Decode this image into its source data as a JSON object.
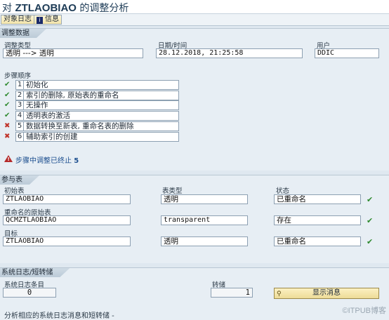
{
  "title": {
    "prefix": "对",
    "object": "ZTLAOBIAO",
    "suffix": "的调整分析"
  },
  "toolbar": {
    "object_log": "对象日志",
    "info": "信息",
    "info_icon": "info-icon"
  },
  "adjust_data": {
    "section_title": "调整数据",
    "adjust_type_label": "调整类型",
    "adjust_type_value": "透明 ---> 透明",
    "datetime_label": "日期/时间",
    "datetime_value": "28.12.2018, 21:25:58",
    "user_label": "用户",
    "user_value": "DDIC"
  },
  "steps": {
    "label": "步骤顺序",
    "items": [
      {
        "status": "ok",
        "icon": "✔",
        "num": "1",
        "text": "初始化"
      },
      {
        "status": "ok",
        "icon": "✔",
        "num": "2",
        "text": "索引的删除, 原始表的重命名"
      },
      {
        "status": "ok",
        "icon": "✔",
        "num": "3",
        "text": "无操作"
      },
      {
        "status": "ok",
        "icon": "✔",
        "num": "4",
        "text": "透明表的激活"
      },
      {
        "status": "err",
        "icon": "✖",
        "num": "5",
        "text": "数据转换至新表, 重命名表的删除"
      },
      {
        "status": "err",
        "icon": "✖",
        "num": "6",
        "text": "辅助索引的创建"
      }
    ],
    "warning_prefix": "步骤中调整已终止",
    "warning_step": "5"
  },
  "params": {
    "section_title": "参与表",
    "rows": [
      {
        "label": "初始表",
        "name": "ZTLAOBIAO",
        "type_label": "表类型",
        "type": "透明",
        "status_label": "状态",
        "status": "已重命名"
      },
      {
        "label": "重命名的原始表",
        "name": "QCMZTLAOBIAO",
        "type_label": "",
        "type": "transparent",
        "status_label": "",
        "status": "存在"
      },
      {
        "label": "目标",
        "name": "ZTLAOBIAO",
        "type_label": "",
        "type": "透明",
        "status_label": "",
        "status": "已重命名"
      }
    ]
  },
  "syslog": {
    "section_title": "系统日志/短转储",
    "entries_label": "系统日志条目",
    "entries_value": "0",
    "dump_label": "转储",
    "dump_value": "1",
    "show_button": "显示消息",
    "footer": "分析相应的系统日志消息和短转储 -"
  },
  "watermark": "©ITPUB博客",
  "colors": {
    "ok": "#2f8a2f",
    "error": "#c0342a",
    "link": "#1d4f8f"
  }
}
